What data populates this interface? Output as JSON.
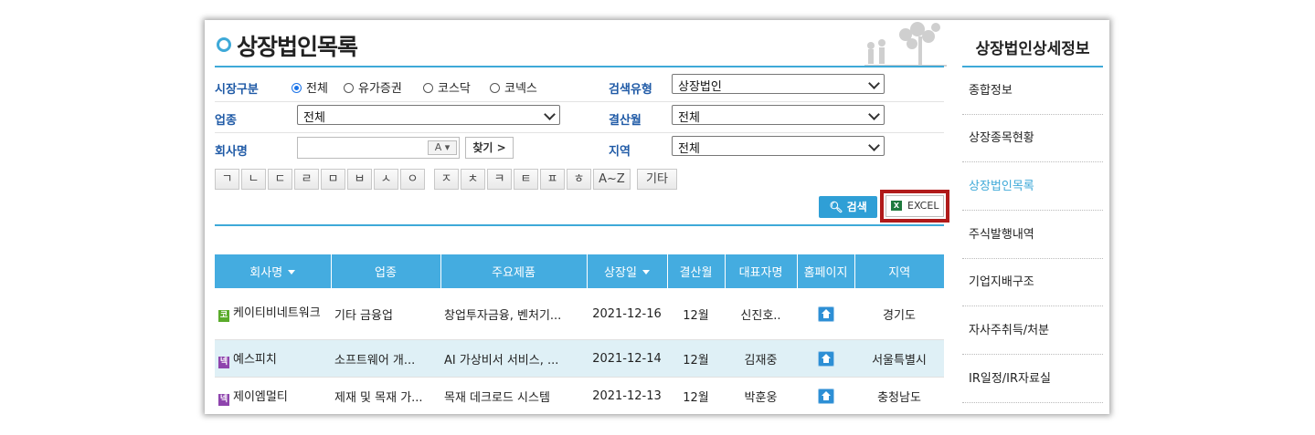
{
  "page": {
    "title": "상장법인목록"
  },
  "filters": {
    "market_label": "시장구분",
    "market_options": [
      {
        "label": "전체",
        "selected": true
      },
      {
        "label": "유가증권",
        "selected": false
      },
      {
        "label": "코스닥",
        "selected": false
      },
      {
        "label": "코넥스",
        "selected": false
      }
    ],
    "search_type_label": "검색유형",
    "search_type_value": "상장법인",
    "industry_label": "업종",
    "industry_value": "전체",
    "settle_month_label": "결산월",
    "settle_month_value": "전체",
    "company_label": "회사명",
    "company_value": "",
    "ak_label": "A",
    "find_label": "찾기 >",
    "region_label": "지역",
    "region_value": "전체",
    "consonants": [
      "ㄱ",
      "ㄴ",
      "ㄷ",
      "ㄹ",
      "ㅁ",
      "ㅂ",
      "ㅅ",
      "ㅇ",
      "ㅈ",
      "ㅊ",
      "ㅋ",
      "ㅌ",
      "ㅍ",
      "ㅎ",
      "A~Z",
      "기타"
    ]
  },
  "actions": {
    "search_label": "검색",
    "excel_label": "EXCEL"
  },
  "table": {
    "headers": [
      "회사명",
      "업종",
      "주요제품",
      "상장일",
      "결산월",
      "대표자명",
      "홈페이지",
      "지역"
    ],
    "rows": [
      {
        "market": "코",
        "market_color": "#5aab2b",
        "name": "케이티비네트워크",
        "industry": "기타 금융업",
        "product": "창업투자금융, 벤처기...",
        "listed": "2021-12-16",
        "settle": "12월",
        "ceo": "신진호..",
        "region": "경기도"
      },
      {
        "market": "넥",
        "market_color": "#8e44ad",
        "name": "예스피치",
        "industry": "소프트웨어 개...",
        "product": "AI 가상비서 서비스, ...",
        "listed": "2021-12-14",
        "settle": "12월",
        "ceo": "김재중",
        "region": "서울특별시"
      },
      {
        "market": "넥",
        "market_color": "#8e44ad",
        "name": "제이엠멀티",
        "industry": "제재 및 목재 가...",
        "product": "목재 데크로드 시스템",
        "listed": "2021-12-13",
        "settle": "12월",
        "ceo": "박훈웅",
        "region": "충청남도"
      }
    ]
  },
  "sidebar": {
    "title": "상장법인상세정보",
    "items": [
      "종합정보",
      "상장종목현황",
      "상장법인목록",
      "주식발행내역",
      "기업지배구조",
      "자사주취득/처분",
      "IR일정/IR자료실"
    ],
    "active": "상장법인목록"
  },
  "colors": {
    "accent": "#3ea9d8",
    "header": "#44ace0",
    "highlight_row": "#dff0f6",
    "excel_border": "#b01a1a"
  }
}
